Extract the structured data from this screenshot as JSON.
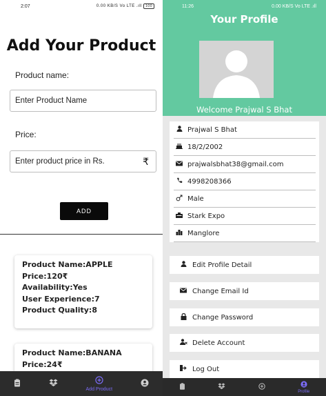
{
  "left": {
    "status_time": "2:07",
    "status_icons": "0.00 KB/S  Vo LTE  .ıll",
    "battery": "100",
    "title": "Add Your Product",
    "name_label": "Product name:",
    "name_placeholder": "Enter Product Name",
    "price_label": "Price:",
    "price_placeholder": "Enter product price in Rs.",
    "currency_symbol": "₹",
    "add_button": "ADD",
    "products": [
      {
        "name": "Product Name:APPLE",
        "price": "Price:120₹",
        "availability": "Availability:Yes",
        "experience": "User Experience:7",
        "quality": "Product Quality:8"
      },
      {
        "name": "Product Name:BANANA",
        "price": "Price:24₹"
      }
    ],
    "nav": [
      {
        "icon": "clipboard-icon"
      },
      {
        "icon": "dropbox-icon"
      },
      {
        "icon": "add-circle-icon",
        "label": "Add Product",
        "active": true
      },
      {
        "icon": "user-circle-icon"
      }
    ]
  },
  "right": {
    "status_time": "11:26",
    "status_icons": "0.00 KB/S  Vo LTE  .ıll",
    "title": "Your Profile",
    "welcome": "Welcome Prajwal S Bhat",
    "info": [
      {
        "icon": "user-icon",
        "value": "Prajwal S Bhat"
      },
      {
        "icon": "birthday-cake-icon",
        "value": "18/2/2002"
      },
      {
        "icon": "envelope-icon",
        "value": "prajwalsbhat38@gmail.com"
      },
      {
        "icon": "phone-icon",
        "value": "4998208366"
      },
      {
        "icon": "gender-icon",
        "value": "Male"
      },
      {
        "icon": "building-icon",
        "value": "Stark Expo"
      },
      {
        "icon": "city-icon",
        "value": "Manglore"
      }
    ],
    "actions": [
      {
        "icon": "user-icon",
        "label": "Edit Profile Detail"
      },
      {
        "icon": "envelope-icon",
        "label": "Change Email Id"
      },
      {
        "icon": "lock-icon",
        "label": "Change Password"
      },
      {
        "icon": "user-delete-icon",
        "label": "Delete Account"
      },
      {
        "icon": "logout-icon",
        "label": "Log Out"
      }
    ],
    "nav": [
      {
        "icon": "clipboard-icon"
      },
      {
        "icon": "dropbox-icon"
      },
      {
        "icon": "add-circle-icon"
      },
      {
        "icon": "user-circle-icon",
        "label": "Profile",
        "active": true
      }
    ]
  },
  "colors": {
    "accent_green": "#63c9a0",
    "nav_active": "#7b6cf6",
    "nav_bg": "#2c2c2c",
    "button_black": "#0a0a0a"
  }
}
